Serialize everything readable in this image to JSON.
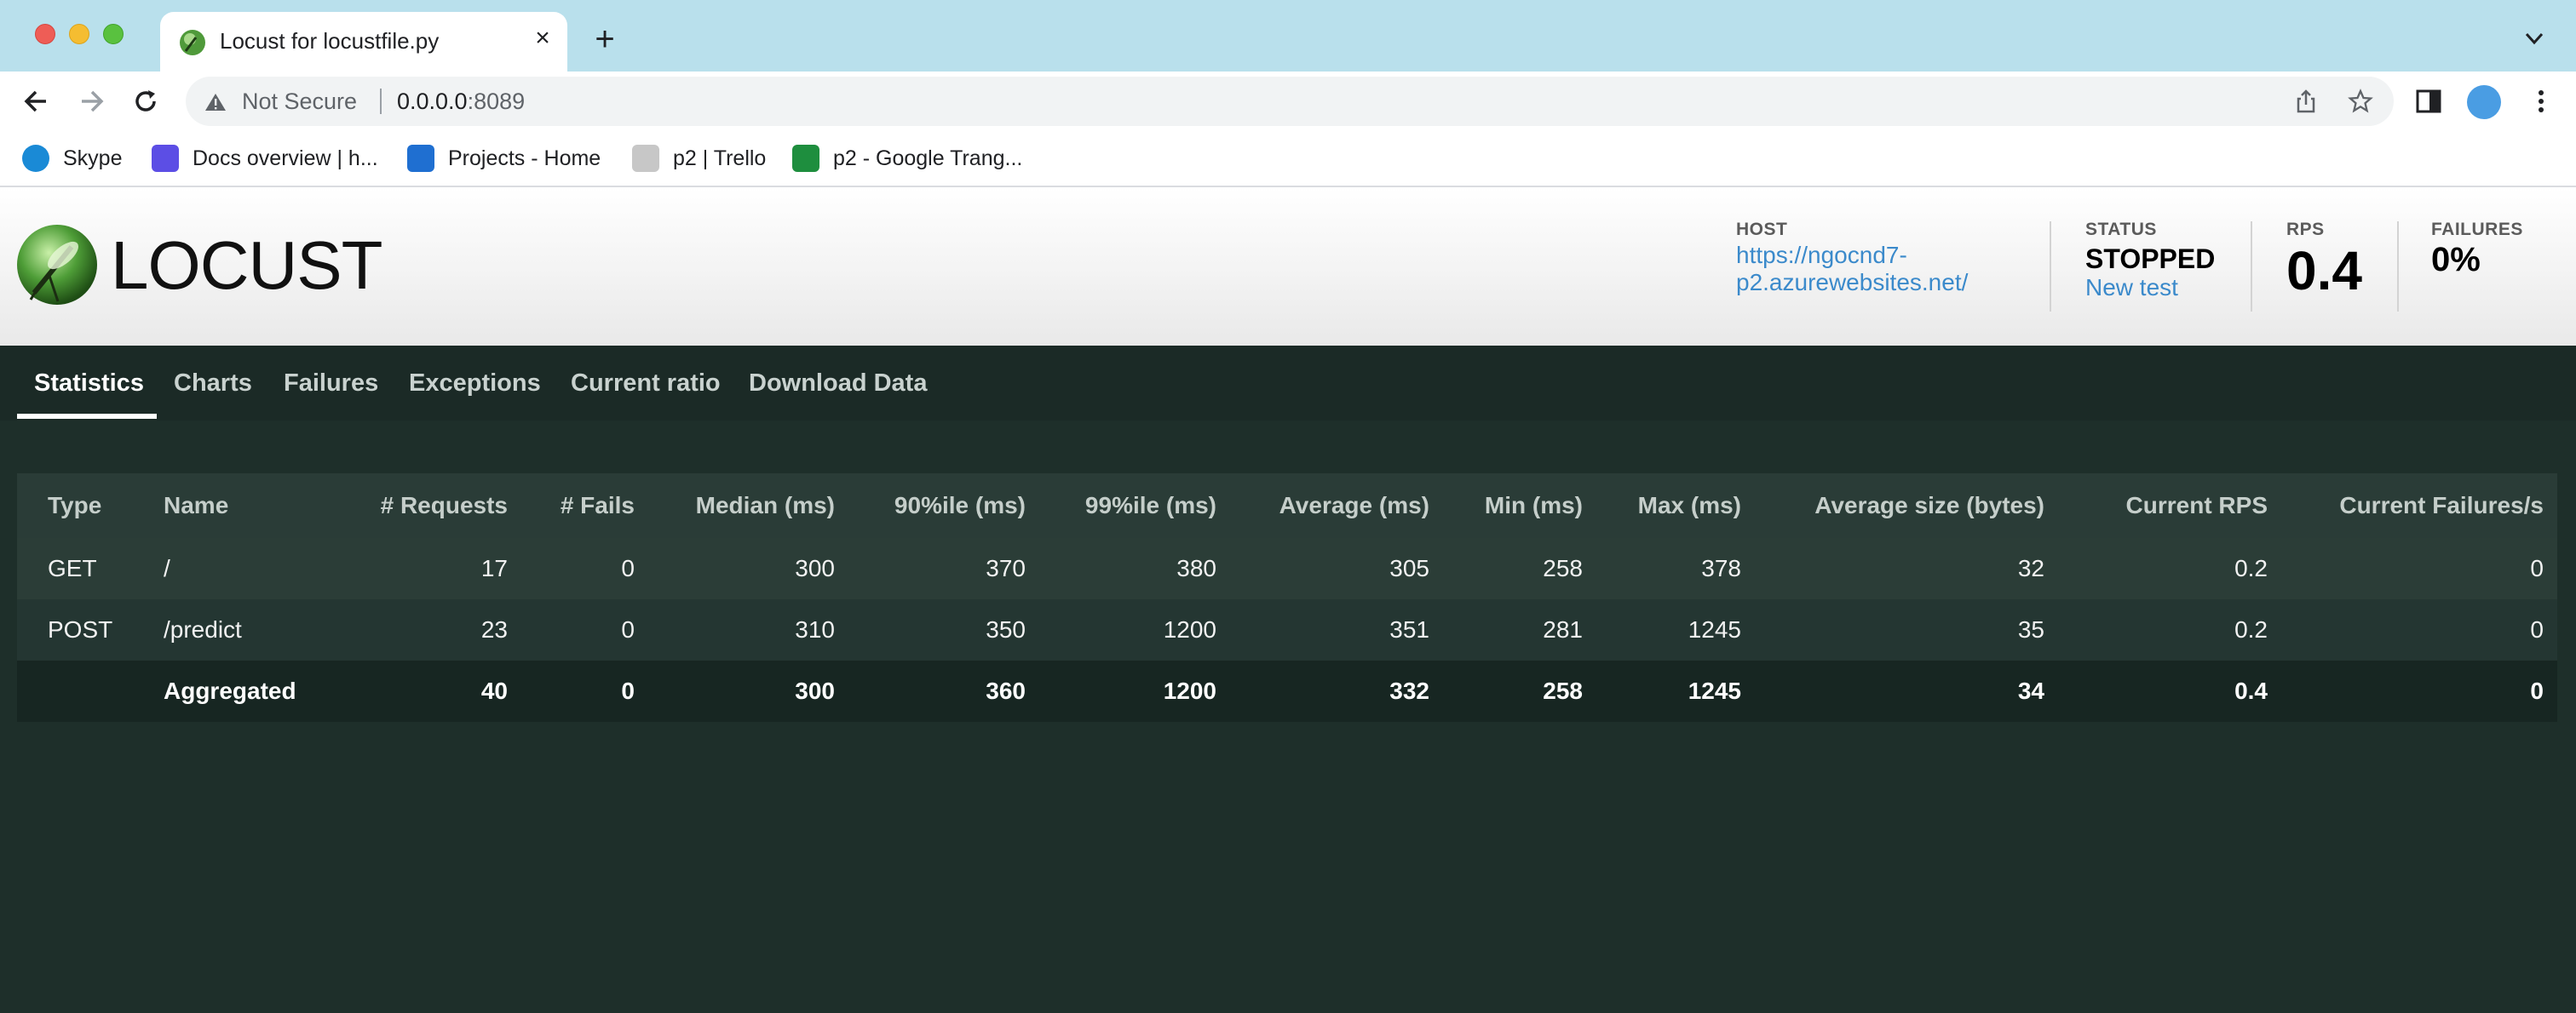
{
  "browser": {
    "tab_title": "Locust for locustfile.py",
    "new_tab_symbol": "+",
    "close_symbol": "×",
    "security_label": "Not Secure",
    "url_host": "0.0.0.0",
    "url_port": ":8089",
    "bookmarks": [
      {
        "label": "Skype",
        "icon": "skype-icon",
        "color": "#1a8ad6"
      },
      {
        "label": "Docs overview | h...",
        "icon": "terraform-icon",
        "color": "#5c4ee5"
      },
      {
        "label": "Projects - Home",
        "icon": "azure-devops-icon",
        "color": "#1f6fd1"
      },
      {
        "label": "p2 | Trello",
        "icon": "trello-icon",
        "color": "#c7c7c7"
      },
      {
        "label": "p2 - Google Trang...",
        "icon": "google-sheets-icon",
        "color": "#1e8e3e"
      }
    ]
  },
  "locust": {
    "logo_text": "LOCUST",
    "host_label": "HOST",
    "host_value": "https://ngocnd7-p2.azurewebsites.net/",
    "host_line1": "https://ngocnd7-",
    "host_line2": "p2.azurewebsites.net/",
    "status_label": "STATUS",
    "status_value": "STOPPED",
    "new_test_label": "New test",
    "rps_label": "RPS",
    "rps_value": "0.4",
    "failures_label": "FAILURES",
    "failures_value": "0%",
    "tabs": [
      "Statistics",
      "Charts",
      "Failures",
      "Exceptions",
      "Current ratio",
      "Download Data"
    ],
    "active_tab": "Statistics"
  },
  "table": {
    "headers": [
      "Type",
      "Name",
      "# Requests",
      "# Fails",
      "Median (ms)",
      "90%ile (ms)",
      "99%ile (ms)",
      "Average (ms)",
      "Min (ms)",
      "Max (ms)",
      "Average size (bytes)",
      "Current RPS",
      "Current Failures/s"
    ],
    "rows": [
      [
        "GET",
        "/",
        "17",
        "0",
        "300",
        "370",
        "380",
        "305",
        "258",
        "378",
        "32",
        "0.2",
        "0"
      ],
      [
        "POST",
        "/predict",
        "23",
        "0",
        "310",
        "350",
        "1200",
        "351",
        "281",
        "1245",
        "35",
        "0.2",
        "0"
      ]
    ],
    "aggregated": [
      "",
      "Aggregated",
      "40",
      "0",
      "300",
      "360",
      "1200",
      "332",
      "258",
      "1245",
      "34",
      "0.4",
      "0"
    ]
  },
  "colors": {
    "page_bg": "#1e2f2a",
    "link": "#3b8acb",
    "tabstrip": "#b9e0ec"
  }
}
